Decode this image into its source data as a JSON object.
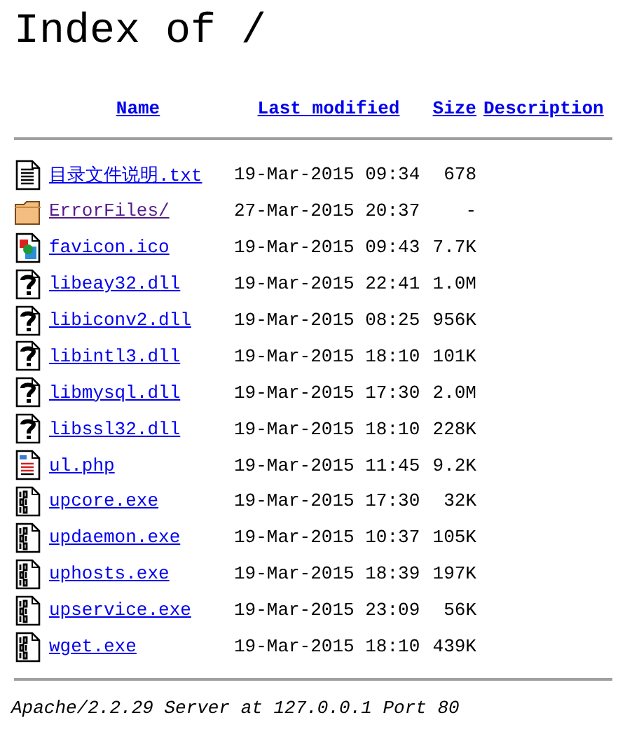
{
  "title": "Index of /",
  "columns": [
    "Name",
    "Last modified",
    "Size",
    "Description"
  ],
  "rows": [
    {
      "kind": "text",
      "name": "目录文件说明.txt",
      "visited": false,
      "modified": "19-Mar-2015 09:34",
      "size": "678"
    },
    {
      "kind": "folder",
      "name": "ErrorFiles/",
      "visited": true,
      "modified": "27-Mar-2015 20:37",
      "size": "-"
    },
    {
      "kind": "image",
      "name": "favicon.ico",
      "visited": false,
      "modified": "19-Mar-2015 09:43",
      "size": "7.7K"
    },
    {
      "kind": "unknown",
      "name": "libeay32.dll",
      "visited": false,
      "modified": "19-Mar-2015 22:41",
      "size": "1.0M"
    },
    {
      "kind": "unknown",
      "name": "libiconv2.dll",
      "visited": false,
      "modified": "19-Mar-2015 08:25",
      "size": "956K"
    },
    {
      "kind": "unknown",
      "name": "libintl3.dll",
      "visited": false,
      "modified": "19-Mar-2015 18:10",
      "size": "101K"
    },
    {
      "kind": "unknown",
      "name": "libmysql.dll",
      "visited": false,
      "modified": "19-Mar-2015 17:30",
      "size": "2.0M"
    },
    {
      "kind": "unknown",
      "name": "libssl32.dll",
      "visited": false,
      "modified": "19-Mar-2015 18:10",
      "size": "228K"
    },
    {
      "kind": "script",
      "name": "ul.php",
      "visited": false,
      "modified": "19-Mar-2015 11:45",
      "size": "9.2K"
    },
    {
      "kind": "binary",
      "name": "upcore.exe",
      "visited": false,
      "modified": "19-Mar-2015 17:30",
      "size": "32K"
    },
    {
      "kind": "binary",
      "name": "updaemon.exe",
      "visited": false,
      "modified": "19-Mar-2015 10:37",
      "size": "105K"
    },
    {
      "kind": "binary",
      "name": "uphosts.exe",
      "visited": false,
      "modified": "19-Mar-2015 18:39",
      "size": "197K"
    },
    {
      "kind": "binary",
      "name": "upservice.exe",
      "visited": false,
      "modified": "19-Mar-2015 23:09",
      "size": "56K"
    },
    {
      "kind": "binary",
      "name": "wget.exe",
      "visited": false,
      "modified": "19-Mar-2015 18:10",
      "size": "439K"
    }
  ],
  "footer": "Apache/2.2.29 Server at 127.0.0.1 Port 80"
}
